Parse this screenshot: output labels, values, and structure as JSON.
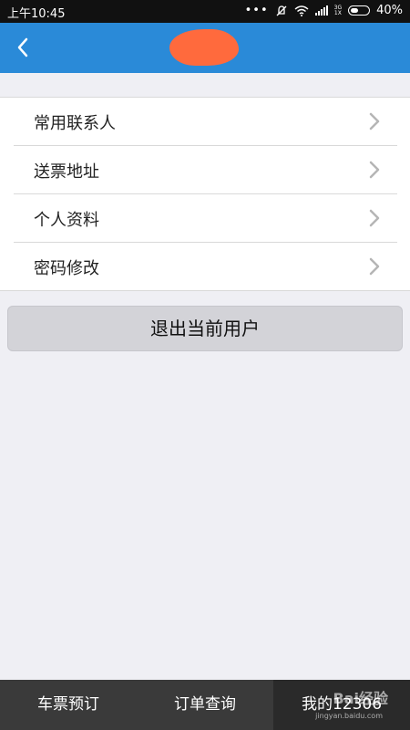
{
  "status_bar": {
    "time": "上午10:45",
    "network": "3G\n1X",
    "battery": "40%",
    "battery_level": 0.4
  },
  "header": {
    "back_icon": "chevron-left-icon",
    "title_redacted_color": "#ff6a3d"
  },
  "menu": {
    "items": [
      {
        "label": "常用联系人"
      },
      {
        "label": "送票地址"
      },
      {
        "label": "个人资料"
      },
      {
        "label": "密码修改"
      }
    ]
  },
  "logout": {
    "label": "退出当前用户"
  },
  "tabbar": {
    "tabs": [
      {
        "label": "车票预订"
      },
      {
        "label": "订单查询"
      },
      {
        "label": "我的12306"
      }
    ],
    "active_index": 2
  },
  "watermark": {
    "logo": "Bai经验",
    "url": "jingyan.baidu.com"
  },
  "colors": {
    "accent": "#2a8ad8",
    "tabbar": "#3a3a3a"
  }
}
